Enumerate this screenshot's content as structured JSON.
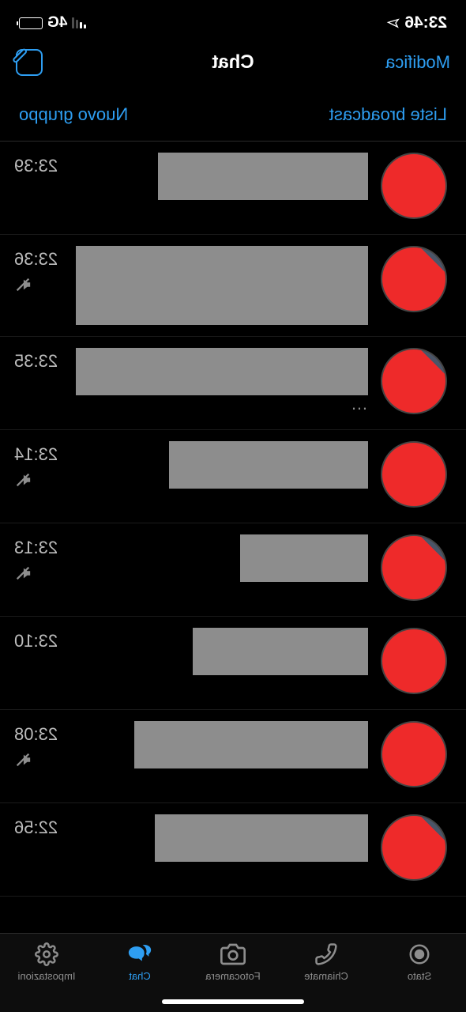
{
  "status": {
    "time": "23:46",
    "network": "4G"
  },
  "nav": {
    "edit": "Modifica",
    "title": "Chat"
  },
  "subnav": {
    "broadcast": "Liste broadcast",
    "newGroup": "Nuovo gruppo"
  },
  "chats": [
    {
      "time": "23:39",
      "muted": false,
      "nameWidth": 266,
      "hasSecondLine": false,
      "avatar": "full"
    },
    {
      "time": "23:36",
      "muted": true,
      "nameWidth": 370,
      "hasSecondLine": false,
      "nameHeight": 100,
      "avatar": "partial"
    },
    {
      "time": "23:35",
      "muted": false,
      "nameWidth": 370,
      "hasSecondLine": true,
      "secondLine": "…",
      "avatar": "partial"
    },
    {
      "time": "23:14",
      "muted": true,
      "nameWidth": 252,
      "hasSecondLine": false,
      "avatar": "full"
    },
    {
      "time": "23:13",
      "muted": true,
      "nameWidth": 162,
      "hasSecondLine": false,
      "avatar": "partial"
    },
    {
      "time": "23:10",
      "muted": false,
      "nameWidth": 222,
      "hasSecondLine": false,
      "avatar": "full"
    },
    {
      "time": "23:08",
      "muted": true,
      "nameWidth": 296,
      "hasSecondLine": false,
      "avatar": "full"
    },
    {
      "time": "22:56",
      "muted": false,
      "nameWidth": 270,
      "hasSecondLine": false,
      "avatar": "partial"
    }
  ],
  "tabs": {
    "status": "Stato",
    "calls": "Chiamate",
    "camera": "Fotocamera",
    "chat": "Chat",
    "settings": "Impostazioni"
  }
}
